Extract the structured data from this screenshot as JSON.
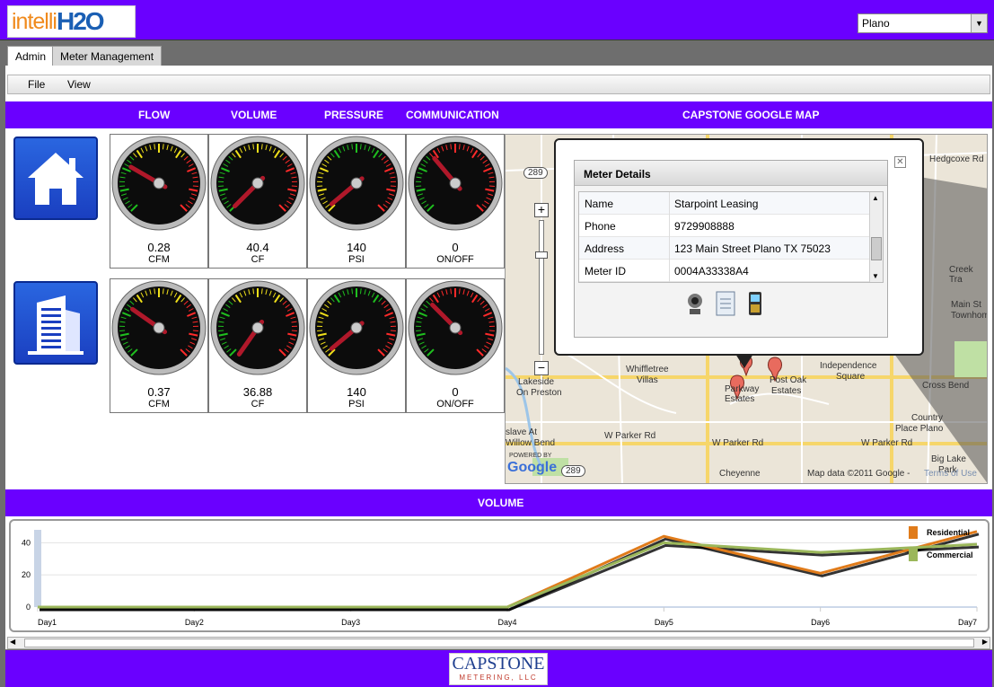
{
  "header": {
    "logo": {
      "part1": "intelli",
      "part2": "H2O"
    },
    "city_select": {
      "value": "Plano"
    }
  },
  "tabs": [
    {
      "label": "Admin"
    },
    {
      "label": "Meter Management"
    }
  ],
  "menu": [
    {
      "label": "File"
    },
    {
      "label": "View"
    }
  ],
  "headers_bar": {
    "flow": "FLOW",
    "volume": "VOLUME",
    "pressure": "PRESSURE",
    "communication": "COMMUNICATION",
    "map": "CAPSTONE GOOGLE MAP"
  },
  "gauges": {
    "residential": [
      {
        "value": "0.28",
        "unit": "CFM"
      },
      {
        "value": "40.4",
        "unit": "CF"
      },
      {
        "value": "140",
        "unit": "PSI"
      },
      {
        "value": "0",
        "unit": "ON/OFF"
      }
    ],
    "commercial": [
      {
        "value": "0.37",
        "unit": "CFM"
      },
      {
        "value": "36.88",
        "unit": "CF"
      },
      {
        "value": "140",
        "unit": "PSI"
      },
      {
        "value": "0",
        "unit": "ON/OFF"
      }
    ]
  },
  "map": {
    "popup_title": "Meter Details",
    "fields": [
      {
        "key": "Name",
        "value": "Starpoint Leasing"
      },
      {
        "key": "Phone",
        "value": "9729908888"
      },
      {
        "key": "Address",
        "value": "123 Main Street Plano TX 75023"
      },
      {
        "key": "Meter ID",
        "value": "0004A33338A4"
      }
    ],
    "labels": {
      "hedgcoxe": "Hedgcoxe Rd",
      "creek": "Creek Tra",
      "main": "Main St",
      "townhome": "Townhom",
      "lakeside": "Lakeside",
      "on_preston": "On Preston",
      "whiffletree": "Whiffletree",
      "villas": "Villas",
      "parkway": "Parkway",
      "estates": "Estates",
      "post_oak": "Post Oak",
      "estates2": "Estates",
      "independence": "Independence",
      "square": "Square",
      "cross_bend": "Cross Bend",
      "country": "Country",
      "place_plano": "Place Plano",
      "w_parker_rd": "W Parker Rd",
      "w_parker_rd2": "W Parker Rd",
      "w_parker_rd3": "W Parker Rd",
      "slave_at": "slave At",
      "willow_bend": "Willow Bend",
      "big_lake": "Big Lake",
      "park": "Park",
      "cheyenne": "Cheyenne",
      "copyright": "Map data ©2011  Google -",
      "terms": "Terms of Use",
      "powered_by": "POWERED BY",
      "google": "Google",
      "shield_289": "289",
      "shield_289b": "289"
    }
  },
  "volume_bar": "VOLUME",
  "chart_data": {
    "type": "line",
    "categories": [
      "Day1",
      "Day2",
      "Day3",
      "Day4",
      "Day5",
      "Day6",
      "Day7"
    ],
    "series": [
      {
        "name": "Residential",
        "values": [
          0,
          0,
          0,
          0,
          44,
          21,
          47
        ]
      },
      {
        "name": "Commercial",
        "values": [
          0,
          0,
          0,
          0,
          40,
          34,
          39
        ]
      }
    ],
    "yticks": [
      "0",
      "20",
      "40"
    ],
    "ylim": [
      0,
      48
    ],
    "colors": {
      "Residential": "#e07b1a",
      "Commercial": "#9bb75a"
    },
    "legend": "top-right"
  },
  "footer": {
    "logo_line1": "CAPSTONE",
    "logo_line2": "METERING, LLC"
  }
}
